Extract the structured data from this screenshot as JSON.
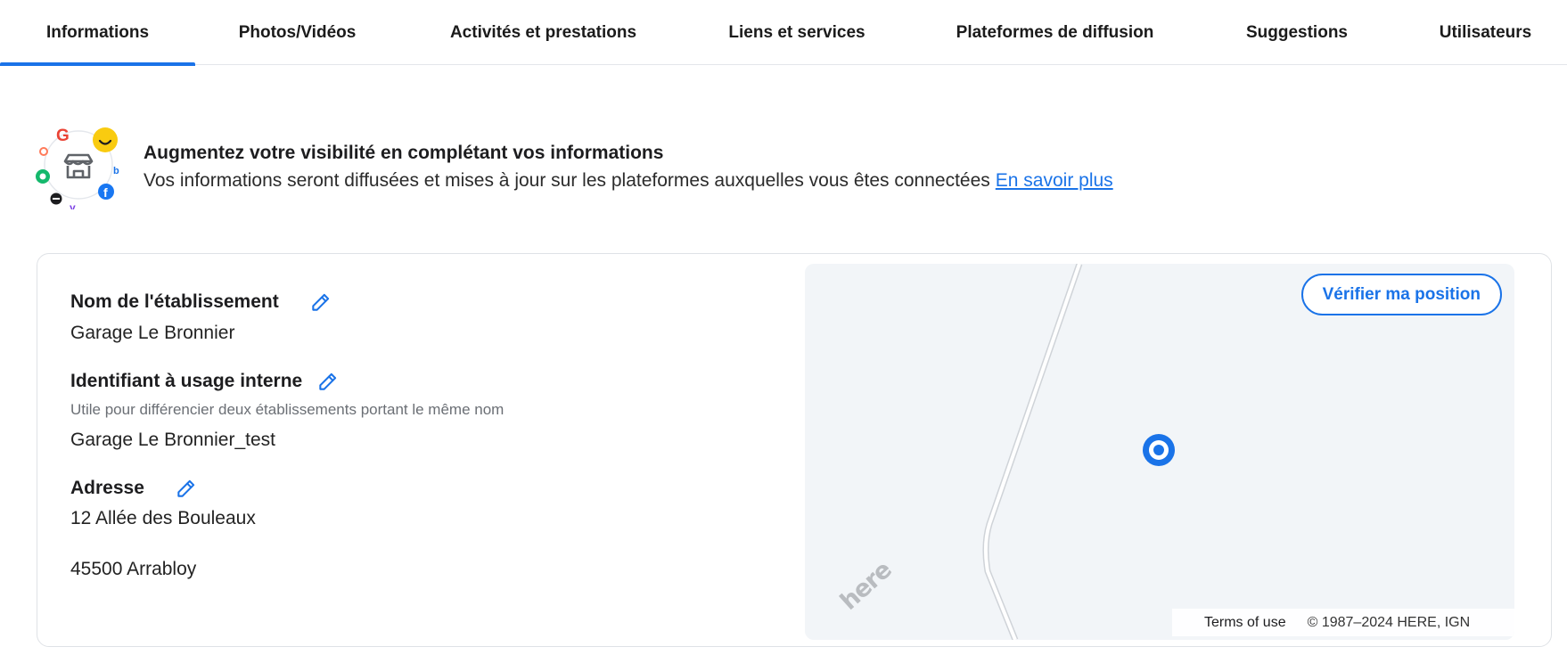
{
  "tabs": [
    {
      "label": "Informations",
      "active": true
    },
    {
      "label": "Photos/Vidéos"
    },
    {
      "label": "Activités et prestations"
    },
    {
      "label": "Liens et services"
    },
    {
      "label": "Plateformes de diffusion"
    },
    {
      "label": "Suggestions"
    },
    {
      "label": "Utilisateurs"
    }
  ],
  "banner": {
    "title": "Augmentez votre visibilité en complétant vos informations",
    "description": "Vos informations seront diffusées et mises à jour sur les plateformes auxquelles vous êtes connectées",
    "link": "En savoir plus"
  },
  "fields": {
    "name": {
      "label": "Nom de l'établissement",
      "value": "Garage Le Bronnier"
    },
    "internal_id": {
      "label": "Identifiant à usage interne",
      "help": "Utile pour différencier deux établissements portant le même nom",
      "value": "Garage Le Bronnier_test"
    },
    "address": {
      "label": "Adresse",
      "line1": "12 Allée des Bouleaux",
      "line2": "45500 Arrabloy"
    }
  },
  "map": {
    "verify_button": "Vérifier ma position",
    "terms": "Terms of use",
    "copyright": "© 1987–2024 HERE, IGN",
    "logo_text": "here"
  },
  "colors": {
    "accent": "#1a73e8",
    "map_bg": "#f2f5f8"
  },
  "icons": {
    "edit": "pencil-icon",
    "pin": "location-pin-icon",
    "banner": "store-platforms-icon"
  }
}
